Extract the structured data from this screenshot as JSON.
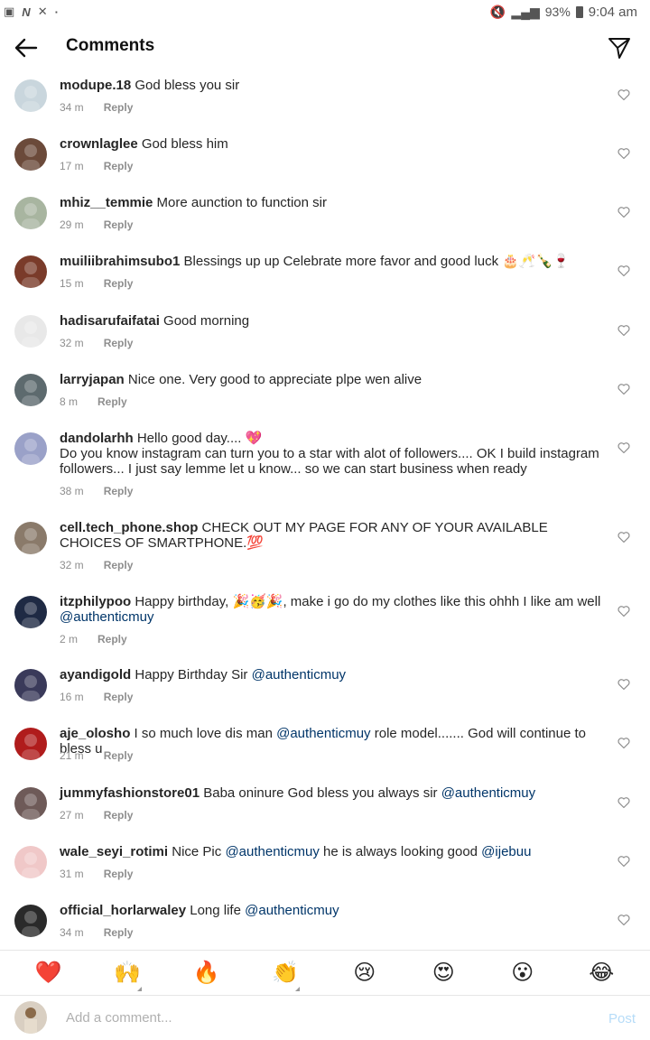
{
  "status_bar": {
    "battery": "93%",
    "time": "9:04 am"
  },
  "header": {
    "title": "Comments"
  },
  "comments": [
    {
      "user": "modupe.18",
      "segments": [
        {
          "t": "God bless you sir"
        }
      ],
      "time": "34 m",
      "reply": "Reply",
      "avatar_color": "#c9d6dd"
    },
    {
      "user": "crownlaglee",
      "segments": [
        {
          "t": "God bless him"
        }
      ],
      "time": "17 m",
      "reply": "Reply",
      "avatar_color": "#6b4a3a"
    },
    {
      "user": "mhiz__temmie",
      "segments": [
        {
          "t": "More aunction to function sir"
        }
      ],
      "time": "29 m",
      "reply": "Reply",
      "avatar_color": "#a8b5a0"
    },
    {
      "user": "muiliibrahimsubo1",
      "segments": [
        {
          "t": "Blessings up up Celebrate more favor and good luck 🎂🥂🍾🍷"
        }
      ],
      "time": "15 m",
      "reply": "Reply",
      "avatar_color": "#7a3b2a"
    },
    {
      "user": "hadisarufaifatai",
      "segments": [
        {
          "t": "Good morning"
        }
      ],
      "time": "32 m",
      "reply": "Reply",
      "avatar_color": "#e8e8e8"
    },
    {
      "user": "larryjapan",
      "segments": [
        {
          "t": "Nice one. Very good to appreciate plpe wen alive"
        }
      ],
      "time": "8 m",
      "reply": "Reply",
      "avatar_color": "#5d6a6e"
    },
    {
      "user": "dandolarhh",
      "segments": [
        {
          "t": "Hello good day.... 💖\n Do you know instagram can turn you to a star with alot of followers.... OK I build instagram followers... I just say lemme let u know... so we can start business when ready"
        }
      ],
      "time": "38 m",
      "reply": "Reply",
      "avatar_color": "#9aa1c8"
    },
    {
      "user": "cell.tech_phone.shop",
      "segments": [
        {
          "t": "CHECK OUT MY PAGE FOR ANY OF YOUR AVAILABLE CHOICES OF SMARTPHONE.💯"
        }
      ],
      "time": "32 m",
      "reply": "Reply",
      "avatar_color": "#8a7a6a"
    },
    {
      "user": "itzphilypoo",
      "segments": [
        {
          "t": "Happy birthday, 🎉🥳🎉, make i go do my clothes like this ohhh I like am well "
        },
        {
          "t": "@authenticmuy",
          "m": true
        }
      ],
      "time": "2 m",
      "reply": "Reply",
      "avatar_color": "#1f2a44"
    },
    {
      "user": "ayandigold",
      "segments": [
        {
          "t": "Happy Birthday Sir "
        },
        {
          "t": "@authenticmuy",
          "m": true
        }
      ],
      "time": "16 m",
      "reply": "Reply",
      "avatar_color": "#3a3a5a"
    },
    {
      "user": "aje_olosho",
      "segments": [
        {
          "t": "I so much love dis man "
        },
        {
          "t": "@authenticmuy",
          "m": true
        },
        {
          "t": " role model....... God will continue to bless u"
        }
      ],
      "time": "21 m",
      "reply": "Reply",
      "avatar_color": "#b01c1c"
    },
    {
      "user": "jummyfashionstore01",
      "segments": [
        {
          "t": "Baba oninure God bless you always sir "
        },
        {
          "t": "@authenticmuy",
          "m": true
        }
      ],
      "time": "27 m",
      "reply": "Reply",
      "avatar_color": "#6e5a58"
    },
    {
      "user": "wale_seyi_rotimi",
      "segments": [
        {
          "t": "Nice Pic "
        },
        {
          "t": "@authenticmuy",
          "m": true
        },
        {
          "t": " he is always looking good "
        },
        {
          "t": "@ijebuu",
          "m": true
        }
      ],
      "time": "31 m",
      "reply": "Reply",
      "avatar_color": "#f0c8c8"
    },
    {
      "user": "official_horlarwaley",
      "segments": [
        {
          "t": "Long life "
        },
        {
          "t": "@authenticmuy",
          "m": true
        }
      ],
      "time": "34 m",
      "reply": "Reply",
      "avatar_color": "#2a2a2a"
    }
  ],
  "reactions": [
    "❤️",
    "🙌",
    "🔥",
    "👏",
    "😢",
    "😍",
    "😮",
    "😂"
  ],
  "add_comment": {
    "placeholder": "Add a comment...",
    "post_label": "Post"
  }
}
